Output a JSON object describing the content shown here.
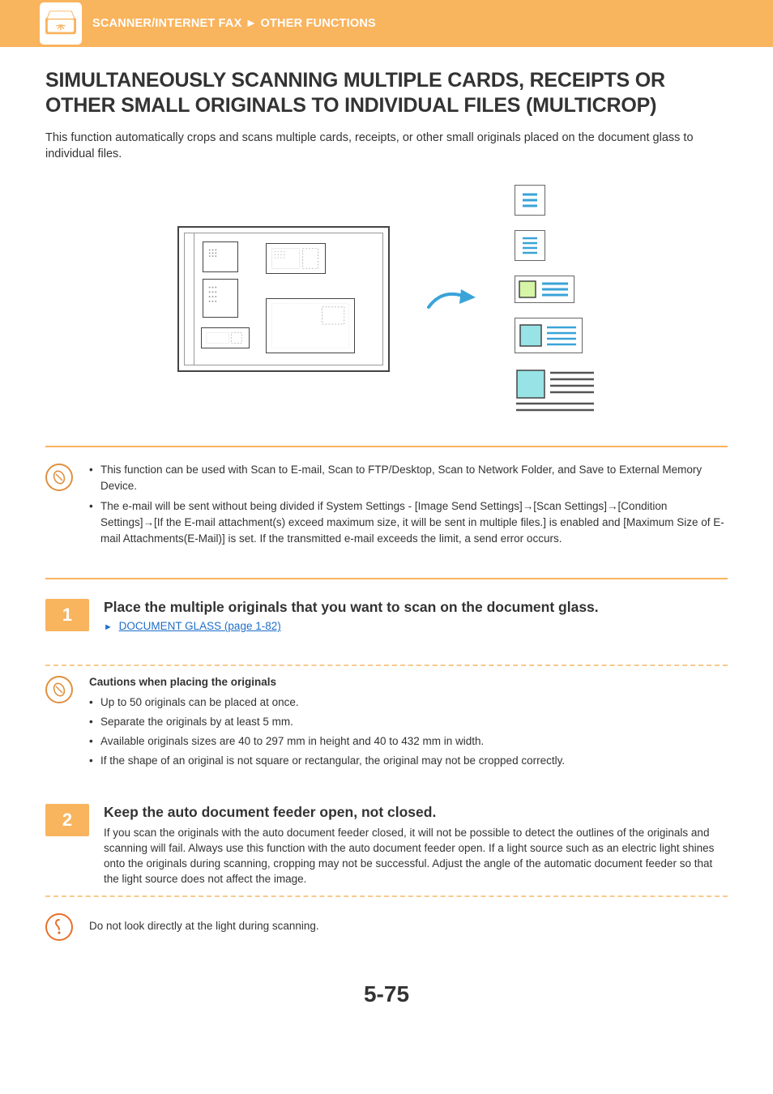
{
  "header": {
    "breadcrumb_left": "SCANNER/INTERNET FAX",
    "breadcrumb_sep": "►",
    "breadcrumb_right": "OTHER FUNCTIONS"
  },
  "title": "SIMULTANEOUSLY SCANNING MULTIPLE CARDS, RECEIPTS OR OTHER SMALL ORIGINALS TO INDIVIDUAL FILES (MULTICROP)",
  "intro": "This function automatically crops and scans multiple cards, receipts, or other small originals placed on the document glass to individual files.",
  "info_bullets": [
    "This function can be used with Scan to E-mail, Scan to FTP/Desktop, Scan to Network Folder, and Save to External Memory Device.",
    "The e-mail will be sent without being divided if System Settings - [Image Send Settings]→[Scan Settings]→[Condition Settings]→[If the E-mail attachment(s) exceed maximum size, it will be sent in multiple files.] is enabled and [Maximum Size of E-mail Attachments(E-Mail)] is set. If the transmitted e-mail exceeds the limit, a send error occurs."
  ],
  "step1": {
    "number": "1",
    "title": "Place the multiple originals that you want to scan on the document glass.",
    "link_text": "DOCUMENT GLASS (page 1-82)"
  },
  "cautions": {
    "heading": "Cautions when placing the originals",
    "items": [
      "Up to 50 originals can be placed at once.",
      "Separate the originals by at least 5 mm.",
      "Available originals sizes are 40 to 297 mm in height and 40 to 432 mm in width.",
      "If the shape of an original is not square or rectangular, the original may not be cropped correctly."
    ]
  },
  "step2": {
    "number": "2",
    "title": "Keep the auto document feeder open, not closed.",
    "body": "If you scan the originals with the auto document feeder closed, it will not be possible to detect the outlines of the originals and scanning will fail. Always use this function with the auto document feeder open. If a light source such as an electric light shines onto the originals during scanning, cropping may not be successful. Adjust the angle of the automatic document feeder so that the light source does not affect the image."
  },
  "warning": "Do not look directly at the light during scanning.",
  "page_number": "5-75"
}
